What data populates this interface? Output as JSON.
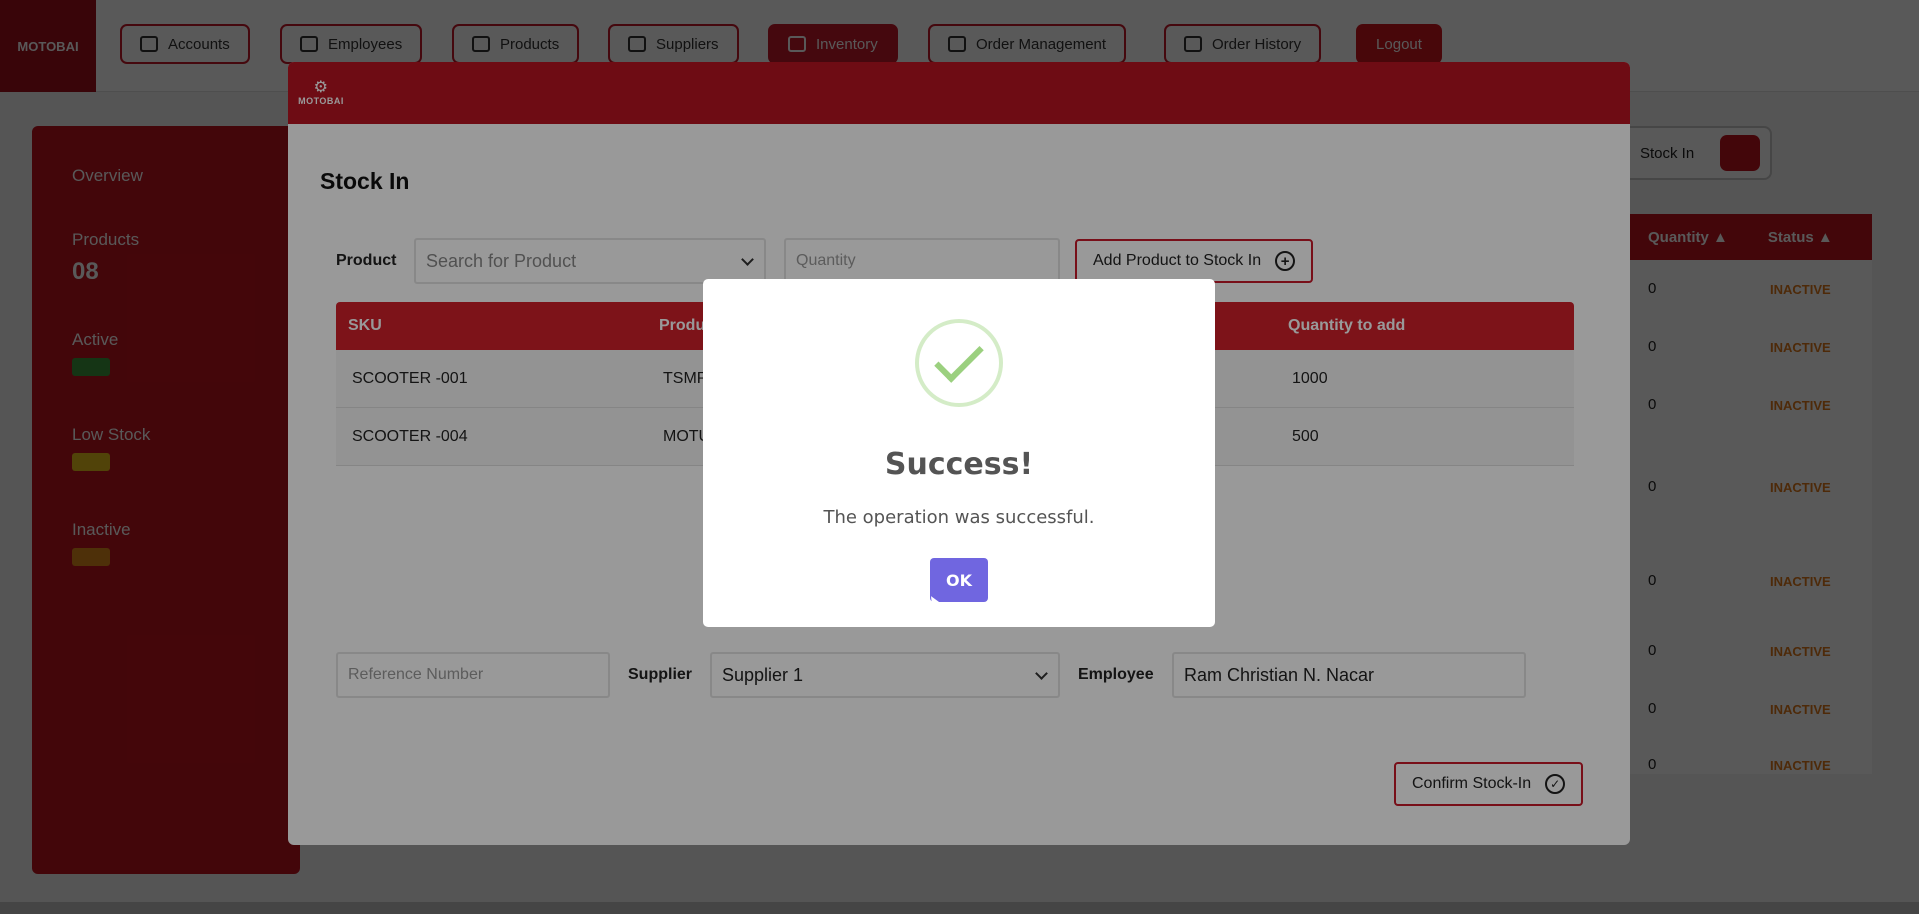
{
  "app": {
    "logo_text": "MOTOBAI",
    "nav": [
      {
        "label": "Accounts",
        "active": false
      },
      {
        "label": "Employees",
        "active": false
      },
      {
        "label": "Products",
        "active": false
      },
      {
        "label": "Suppliers",
        "active": false
      },
      {
        "label": "Inventory",
        "active": true
      },
      {
        "label": "Order Management",
        "active": false
      },
      {
        "label": "Order History",
        "active": false
      }
    ],
    "logout_label": "Logout",
    "sidebar": {
      "overview_label": "Overview",
      "products_label": "Products",
      "products_value": "08",
      "active_label": "Active",
      "low_stock_label": "Low Stock",
      "inactive_label": "Inactive"
    },
    "stock_in_button": "Stock In",
    "table": {
      "headers": [
        "Quantity ▲",
        "Status ▲"
      ],
      "quantities": [
        "0",
        "0",
        "0",
        "0",
        "0",
        "0",
        "0",
        "0"
      ],
      "status": "INACTIVE"
    }
  },
  "modal": {
    "logo_text": "MOTOBAI",
    "title": "Stock In",
    "product_label": "Product",
    "product_placeholder": "Search for Product",
    "quantity_placeholder": "Quantity",
    "add_button": "Add Product to Stock In",
    "table": {
      "headers": [
        "SKU",
        "Product",
        "Quantity to add"
      ],
      "rows": [
        {
          "sku": "SCOOTER -001",
          "product": "TSMP",
          "quantity": "1000"
        },
        {
          "sku": "SCOOTER -004",
          "product": "MOTU",
          "quantity": "500"
        }
      ]
    },
    "reference_placeholder": "Reference Number",
    "supplier_label": "Supplier",
    "supplier_value": "Supplier 1",
    "employee_label": "Employee",
    "employee_value": "Ram Christian N. Nacar",
    "confirm_button": "Confirm Stock-In"
  },
  "dialog": {
    "icon": "success-check-icon",
    "title": "Success!",
    "text": "The operation was successful.",
    "ok_label": "OK",
    "ok_color": "#7066e0"
  },
  "colors": {
    "brand_red": "#c8192a",
    "modal_header": "#b81422",
    "success_green": "#9bd07f"
  }
}
